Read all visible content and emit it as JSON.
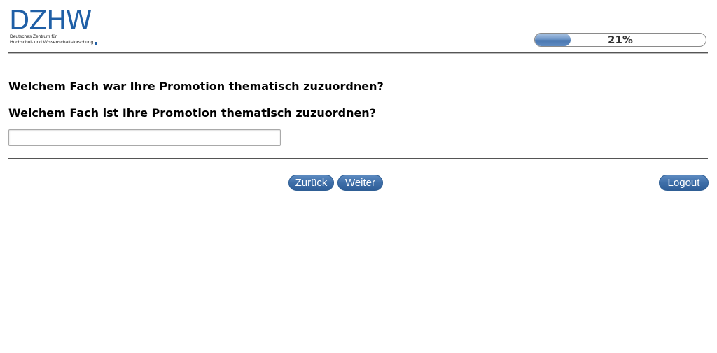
{
  "logo": {
    "word": "DZHW",
    "subtitle_line1": "Deutsches Zentrum für",
    "subtitle_line2": "Hochschul- und Wissenschaftsforschung",
    "brand_color": "#1f5fa6"
  },
  "progress": {
    "value_percent": 21,
    "label": "21%"
  },
  "questions": {
    "q1": "Welchem Fach war Ihre Promotion thematisch zuzuordnen?",
    "q2": "Welchem Fach ist Ihre Promotion thematisch zuzuordnen?"
  },
  "answer": {
    "value": "",
    "placeholder": ""
  },
  "nav": {
    "back_label": "Zurück",
    "next_label": "Weiter",
    "logout_label": "Logout",
    "button_color": "#3e6ea8"
  }
}
